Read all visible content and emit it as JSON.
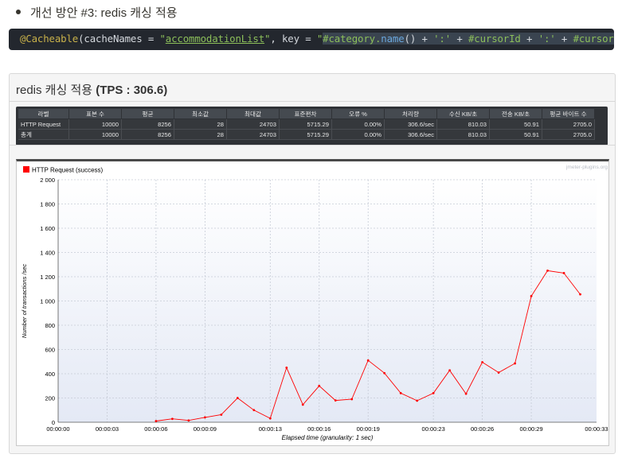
{
  "bullet": {
    "text": "개선 방안 #3: redis 캐싱 적용"
  },
  "code": {
    "line1": [
      {
        "t": "@Cacheable",
        "c": "tk-ann"
      },
      {
        "t": "(cacheNames = ",
        "c": "tk-plain"
      },
      {
        "t": "\"",
        "c": "tk-str"
      },
      {
        "t": "accommodationList",
        "c": "tk-str-ul"
      },
      {
        "t": "\"",
        "c": "tk-str"
      },
      {
        "t": ", key = ",
        "c": "tk-plain"
      },
      {
        "t": "\"",
        "c": "tk-str"
      },
      {
        "t": "#category.",
        "c": "tk-str tk-sel"
      },
      {
        "t": "name",
        "c": "tk-fn tk-sel"
      },
      {
        "t": "()",
        "c": "tk-plain tk-sel"
      },
      {
        "t": " + ",
        "c": "tk-plain tk-sel"
      },
      {
        "t": "':'",
        "c": "tk-str tk-sel"
      },
      {
        "t": " + ",
        "c": "tk-plain tk-sel"
      },
      {
        "t": "#cursorId",
        "c": "tk-str tk-sel"
      },
      {
        "t": " + ",
        "c": "tk-plain tk-sel"
      },
      {
        "t": "':'",
        "c": "tk-str tk-sel"
      },
      {
        "t": " + ",
        "c": "tk-plain tk-sel"
      },
      {
        "t": "#cursorMinPrice",
        "c": "tk-str tk-sel"
      },
      {
        "t": "\")",
        "c": "tk-plain"
      }
    ]
  },
  "panel": {
    "title": "redis 캐싱 적용 ",
    "title_bold": "(TPS : 306.6)"
  },
  "table": {
    "headers": [
      "라벨",
      "표본 수",
      "평균",
      "최소값",
      "최대값",
      "표준편차",
      "오류 %",
      "처리량",
      "수신 KB/초",
      "전송 KB/초",
      "평균 바이트 수"
    ],
    "rows": [
      [
        "HTTP Request",
        "10000",
        "8256",
        "28",
        "24703",
        "5715.29",
        "0.00%",
        "306.6/sec",
        "810.03",
        "50.91",
        "2705.0"
      ],
      [
        "총계",
        "10000",
        "8256",
        "28",
        "24703",
        "5715.29",
        "0.00%",
        "306.6/sec",
        "810.03",
        "50.91",
        "2705.0"
      ]
    ]
  },
  "chart_data": {
    "type": "line",
    "title": "",
    "legend": [
      "HTTP Request (success)"
    ],
    "watermark": "jmeter-plugins.org",
    "xlabel": "Elapsed time (granularity: 1 sec)",
    "ylabel": "Number of transactions /sec",
    "ylim": [
      0,
      2000
    ],
    "xlim": [
      0,
      33
    ],
    "y_ticks": [
      "0",
      "200",
      "400",
      "600",
      "800",
      "1 000",
      "1 200",
      "1 400",
      "1 600",
      "1 800",
      "2 000"
    ],
    "x_ticks": [
      "00:00:00",
      "00:00:03",
      "00:00:06",
      "00:00:09",
      "00:00:13",
      "00:00:16",
      "00:00:19",
      "00:00:23",
      "00:00:26",
      "00:00:29",
      "00:00:33"
    ],
    "x_tick_seconds": [
      0,
      3,
      6,
      9,
      13,
      16,
      19,
      23,
      26,
      29,
      33
    ],
    "series": [
      {
        "name": "HTTP Request (success)",
        "color": "#ff0000",
        "x": [
          6,
          7,
          8,
          9,
          10,
          11,
          12,
          13,
          14,
          15,
          16,
          17,
          18,
          19,
          20,
          21,
          22,
          23,
          24,
          25,
          26,
          27,
          28,
          29,
          30,
          31,
          32
        ],
        "values": [
          10,
          28,
          15,
          40,
          62,
          200,
          100,
          32,
          450,
          145,
          300,
          180,
          190,
          510,
          405,
          240,
          178,
          240,
          428,
          235,
          495,
          410,
          485,
          1040,
          1250,
          1230,
          1055
        ]
      }
    ]
  },
  "colors": {
    "line": "#ff0000",
    "plot_bg_top": "#ffffff",
    "plot_bg_bottom": "#e4e9f5",
    "grid": "#c6cbd6"
  }
}
